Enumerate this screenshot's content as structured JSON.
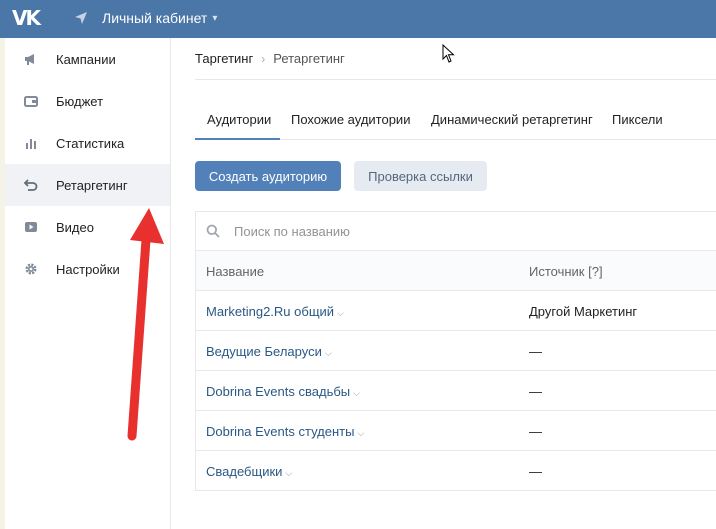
{
  "header": {
    "logo": "VK",
    "title": "Личный кабинет"
  },
  "sidebar": {
    "items": [
      {
        "label": "Кампании",
        "icon": "megaphone-icon"
      },
      {
        "label": "Бюджет",
        "icon": "wallet-icon"
      },
      {
        "label": "Статистика",
        "icon": "bar-chart-icon"
      },
      {
        "label": "Ретаргетинг",
        "icon": "retarget-icon",
        "active": true
      },
      {
        "label": "Видео",
        "icon": "play-icon"
      },
      {
        "label": "Настройки",
        "icon": "gear-icon"
      }
    ]
  },
  "breadcrumb": {
    "root": "Таргетинг",
    "current": "Ретаргетинг"
  },
  "tabs": [
    "Аудитории",
    "Похожие аудитории",
    "Динамический ретаргетинг",
    "Пиксели"
  ],
  "buttons": {
    "create": "Создать аудиторию",
    "check": "Проверка ссылки"
  },
  "search": {
    "placeholder": "Поиск по названию"
  },
  "table": {
    "columns": [
      "Название",
      "Источник [?]"
    ],
    "rows": [
      {
        "name": "Marketing2.Ru общий",
        "source": "Другой Маркетинг"
      },
      {
        "name": "Ведущие Беларуси",
        "source": "—"
      },
      {
        "name": "Dobrina Events свадьбы",
        "source": "—"
      },
      {
        "name": "Dobrina Events студенты",
        "source": "—"
      },
      {
        "name": "Свадебщики",
        "source": "—"
      }
    ]
  },
  "colors": {
    "header_bg": "#4a76a8",
    "primary": "#5181b8",
    "annotation_arrow": "#e8312f"
  }
}
